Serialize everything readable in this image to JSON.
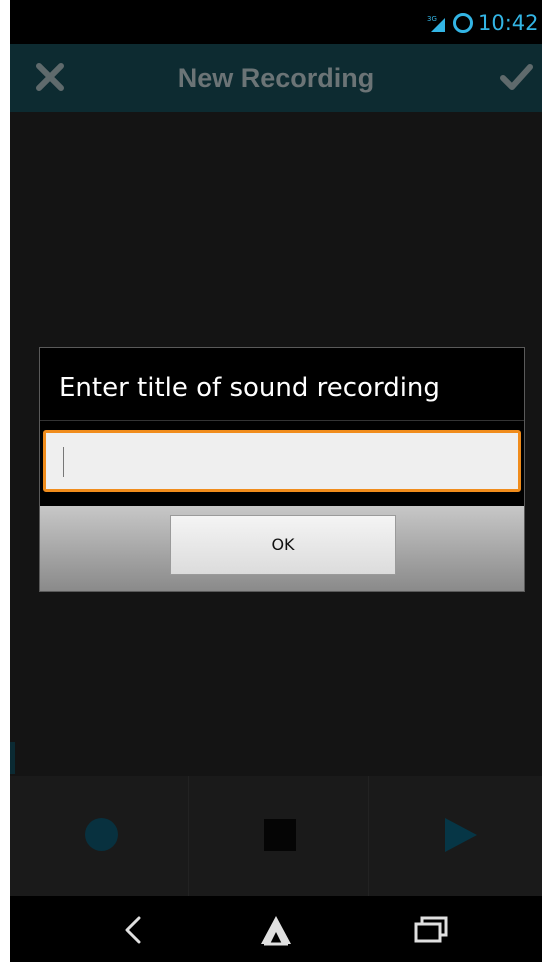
{
  "status_bar": {
    "time": "10:42",
    "network": "3G",
    "accent": "#33b5e5"
  },
  "action_bar": {
    "title": "New Recording",
    "close_icon": "close-icon",
    "confirm_icon": "check-icon"
  },
  "dialog": {
    "title": "Enter title of sound recording",
    "input_value": "",
    "ok_label": "OK",
    "accent": "#f08c1c"
  },
  "controls": {
    "record_icon": "record-icon",
    "stop_icon": "stop-icon",
    "play_icon": "play-icon"
  },
  "nav_bar": {
    "back_icon": "back-icon",
    "home_icon": "home-icon",
    "recents_icon": "recent-apps-icon"
  }
}
